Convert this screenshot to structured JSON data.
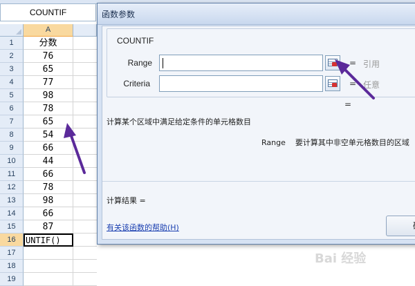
{
  "sheet": {
    "name_box": "COUNTIF",
    "column_a_header": "A",
    "rows": [
      {
        "num": "1",
        "value": "分数"
      },
      {
        "num": "2",
        "value": "76"
      },
      {
        "num": "3",
        "value": "65"
      },
      {
        "num": "4",
        "value": "77"
      },
      {
        "num": "5",
        "value": "98"
      },
      {
        "num": "6",
        "value": "78"
      },
      {
        "num": "7",
        "value": "65"
      },
      {
        "num": "8",
        "value": "54"
      },
      {
        "num": "9",
        "value": "66"
      },
      {
        "num": "10",
        "value": "44"
      },
      {
        "num": "11",
        "value": "66"
      },
      {
        "num": "12",
        "value": "78"
      },
      {
        "num": "13",
        "value": "98"
      },
      {
        "num": "14",
        "value": "66"
      },
      {
        "num": "15",
        "value": "87"
      },
      {
        "num": "16",
        "value": "UNTIF()"
      },
      {
        "num": "17",
        "value": ""
      },
      {
        "num": "18",
        "value": ""
      },
      {
        "num": "19",
        "value": ""
      }
    ],
    "active_row": "16"
  },
  "dialog": {
    "title": "函数参数",
    "function_name": "COUNTIF",
    "range_label": "Range",
    "criteria_label": "Criteria",
    "range_value": "",
    "criteria_value": "",
    "equals": "=",
    "range_hint": "引用",
    "criteria_hint": "任意",
    "description": "计算某个区域中满足给定条件的单元格数目",
    "range_param_name": "Range",
    "range_param_desc": "要计算其中非空单元格数目的区域",
    "result_label": "计算结果 =",
    "help_link": "有关该函数的帮助(H)",
    "ok_label": "确"
  },
  "watermark": "Bai 经验"
}
